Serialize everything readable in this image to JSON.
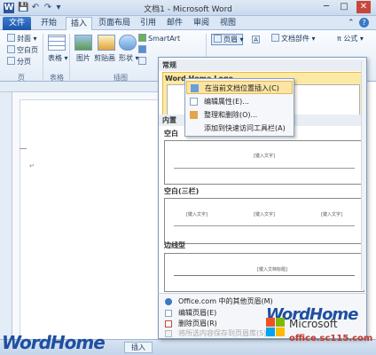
{
  "window": {
    "title": "文档1 - Microsoft Word",
    "quick_access": [
      "W",
      "💾",
      "↶",
      "↷",
      "▾"
    ],
    "controls": [
      "─",
      "□",
      "✕"
    ]
  },
  "tabs": [
    {
      "label": "文件"
    },
    {
      "label": "开始"
    },
    {
      "label": "插入"
    },
    {
      "label": "页面布局"
    },
    {
      "label": "引用"
    },
    {
      "label": "邮件"
    },
    {
      "label": "审阅"
    },
    {
      "label": "视图"
    }
  ],
  "ribbon": {
    "pages_group": {
      "items": [
        "封面",
        "空白页",
        "分页"
      ],
      "label": "页"
    },
    "table_group": {
      "button": "表格",
      "label": "表格"
    },
    "illustrations_group": {
      "buttons": [
        "图片",
        "剪贴画",
        "形状"
      ],
      "smartart": "SmartArt",
      "label": "插图"
    },
    "header_button": "页眉",
    "doc_parts": "文档部件",
    "formula": "公式",
    "misc_icons": [
      "A",
      "π"
    ]
  },
  "gallery": {
    "section_general": "常规",
    "item_wordhome": "Word Home Logo",
    "section_builtin": "内置",
    "item_blank": "空白",
    "item_blank_three": "空白(三栏)",
    "item_border": "边线型",
    "placeholder_text": "[键入文字]",
    "placeholder_text2": "[键入文档标题]"
  },
  "context_menu": {
    "items": [
      {
        "label": "在当前文档位置插入(C)",
        "icon": "insert-icon"
      },
      {
        "label": "编辑属性(E)...",
        "icon": "edit-icon"
      },
      {
        "label": "整理和删除(O)...",
        "icon": "organize-icon"
      },
      {
        "label": "添加到快速访问工具栏(A)",
        "icon": "add-icon"
      }
    ]
  },
  "commands": {
    "items": [
      {
        "label": "Office.com 中的其他页眉(M)",
        "icon": "globe-icon",
        "enabled": true
      },
      {
        "label": "编辑页眉(E)",
        "icon": "edit-header-icon",
        "enabled": true
      },
      {
        "label": "删除页眉(R)",
        "icon": "delete-header-icon",
        "enabled": true
      },
      {
        "label": "将所选内容保存到页眉库(S)...",
        "icon": "save-gallery-icon",
        "enabled": false
      }
    ]
  },
  "statusbar": {
    "doc_tab": "插入"
  },
  "watermarks": {
    "left": "WordHome",
    "right": "WordHome",
    "ms_top": "Microsoft",
    "ms_bottom": "office.sc115.com"
  },
  "colors": {
    "accent": "#2b579a",
    "highlight": "#fde9a6",
    "highlight_border": "#e8b84a"
  }
}
